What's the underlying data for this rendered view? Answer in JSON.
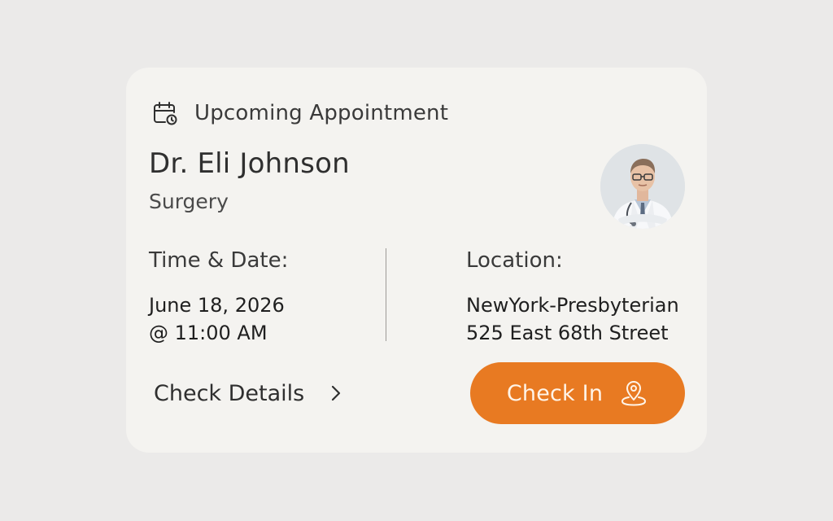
{
  "card": {
    "header": {
      "icon": "calendar-clock-icon",
      "label": "Upcoming Appointment"
    },
    "doctor": {
      "name": "Dr. Eli Johnson",
      "specialty": "Surgery",
      "avatar": "doctor-avatar"
    },
    "time_date": {
      "label": "Time & Date:",
      "line1": "June 18, 2026",
      "line2": "@ 11:00 AM"
    },
    "location": {
      "label": "Location:",
      "line1": "NewYork-Presbyterian",
      "line2": "525 East 68th Street"
    },
    "actions": {
      "details_label": "Check Details",
      "details_icon": "chevron-right-icon",
      "checkin_label": "Check In",
      "checkin_icon": "map-pin-icon"
    }
  },
  "colors": {
    "background": "#ebeae9",
    "card": "#f4f3f0",
    "accent": "#e87a22",
    "text": "#2f2f2f"
  }
}
